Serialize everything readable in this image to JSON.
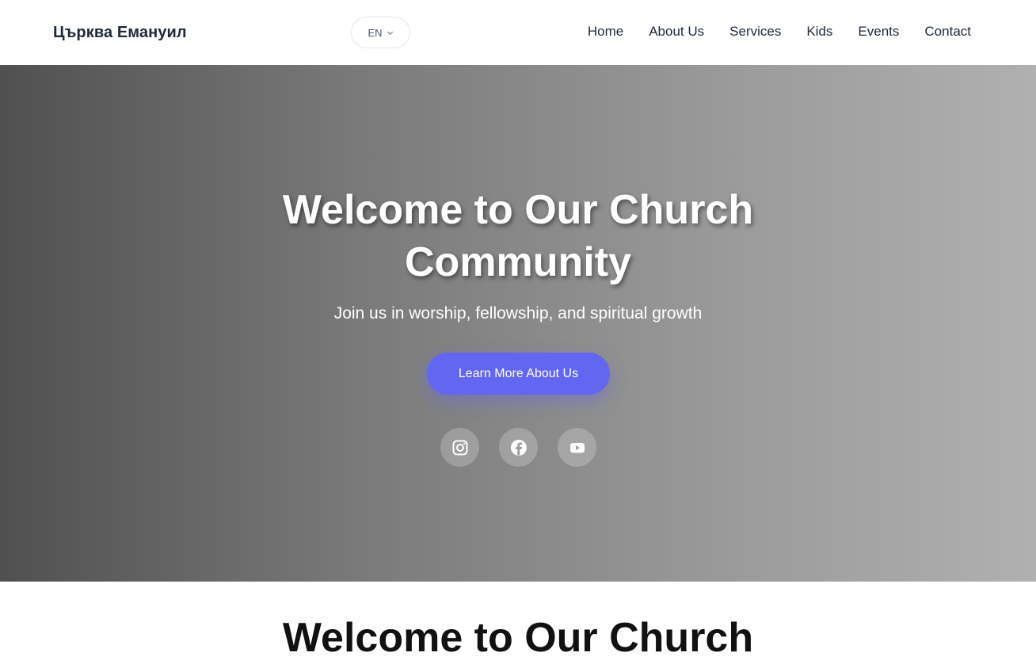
{
  "header": {
    "brand": "Църква Емануил",
    "language": "EN",
    "nav": [
      "Home",
      "About Us",
      "Services",
      "Kids",
      "Events",
      "Contact"
    ]
  },
  "hero": {
    "title": "Welcome to Our Church Community",
    "subtitle": "Join us in worship, fellowship, and spiritual growth",
    "cta_label": "Learn More About Us",
    "social": [
      "instagram-icon",
      "facebook-icon",
      "youtube-icon"
    ]
  },
  "section": {
    "title": "Welcome to Our Church"
  },
  "colors": {
    "accent": "#6366f1"
  }
}
